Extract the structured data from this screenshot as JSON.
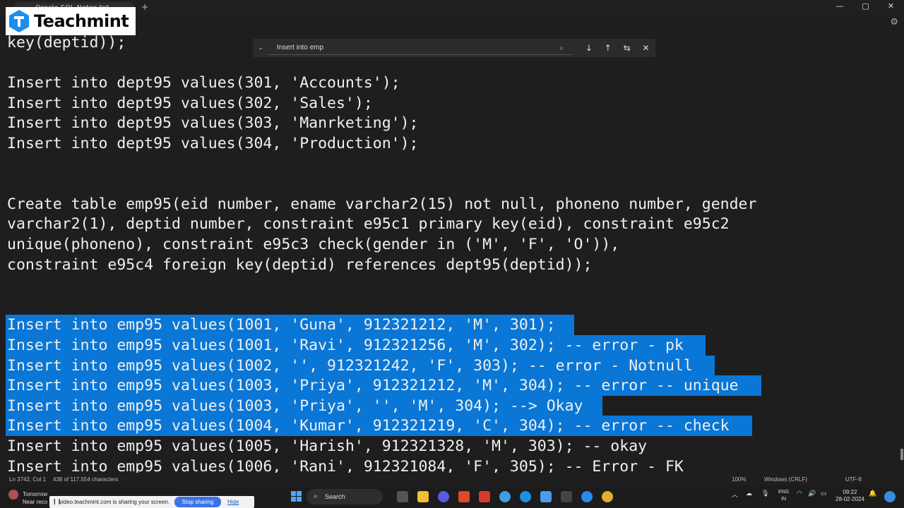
{
  "window": {
    "tab_label": "Oracle SQL Notes.txt",
    "controls": [
      "—",
      "▢",
      "✕"
    ]
  },
  "logo": {
    "text": "Teachmint"
  },
  "find": {
    "value": "Insert into emp",
    "buttons": [
      "↓",
      "↑",
      "⇆",
      "✕"
    ]
  },
  "editor": {
    "lines": [
      "key(deptid));",
      "",
      "Insert into dept95 values(301, 'Accounts');",
      "Insert into dept95 values(302, 'Sales');",
      "Insert into dept95 values(303, 'Manrketing');",
      "Insert into dept95 values(304, 'Production');",
      "",
      "",
      "Create table emp95(eid number, ename varchar2(15) not null, phoneno number, gender",
      "varchar2(1), deptid number, constraint e95c1 primary key(eid), constraint e95c2",
      "unique(phoneno), constraint e95c3 check(gender in ('M', 'F', 'O')),",
      "constraint e95c4 foreign key(deptid) references dept95(deptid));",
      "",
      "",
      "Insert into emp95 values(1001, 'Guna', 912321212, 'M', 301);",
      "Insert into emp95 values(1001, 'Ravi', 912321256, 'M', 302); -- error - pk",
      "Insert into emp95 values(1002, '', 912321242, 'F', 303); -- error - Notnull",
      "Insert into emp95 values(1003, 'Priya', 912321212, 'M', 304); -- error -- unique",
      "Insert into emp95 values(1003, 'Priya', '', 'M', 304); --> Okay",
      "Insert into emp95 values(1004, 'Kumar', 912321219, 'C', 304); -- error -- check",
      "Insert into emp95 values(1005, 'Harish', 912321328, 'M', 303); -- okay",
      "Insert into emp95 values(1006, 'Rani', 912321084, 'F', 305); -- Error - FK"
    ],
    "selected_lines": [
      14,
      15,
      16,
      17,
      18,
      19
    ]
  },
  "status": {
    "position": "Ln 3742, Col 1",
    "chars": "438 of 117,554 characters",
    "zoom": "100%",
    "eol": "Windows (CRLF)",
    "encoding": "UTF-8"
  },
  "taskbar": {
    "weather_line1": "Tomorrow",
    "weather_line2": "Near reco",
    "share_message": "video.teachmint.com is sharing your screen.",
    "stop_sharing": "Stop sharing",
    "hide": "Hide",
    "search": "Search",
    "lang1": "ENG",
    "lang2": "IN",
    "time": "09:22",
    "date": "28-02-2024"
  },
  "colors": {
    "selection": "#0a76d6",
    "editor_bg": "#1e1e1e"
  }
}
